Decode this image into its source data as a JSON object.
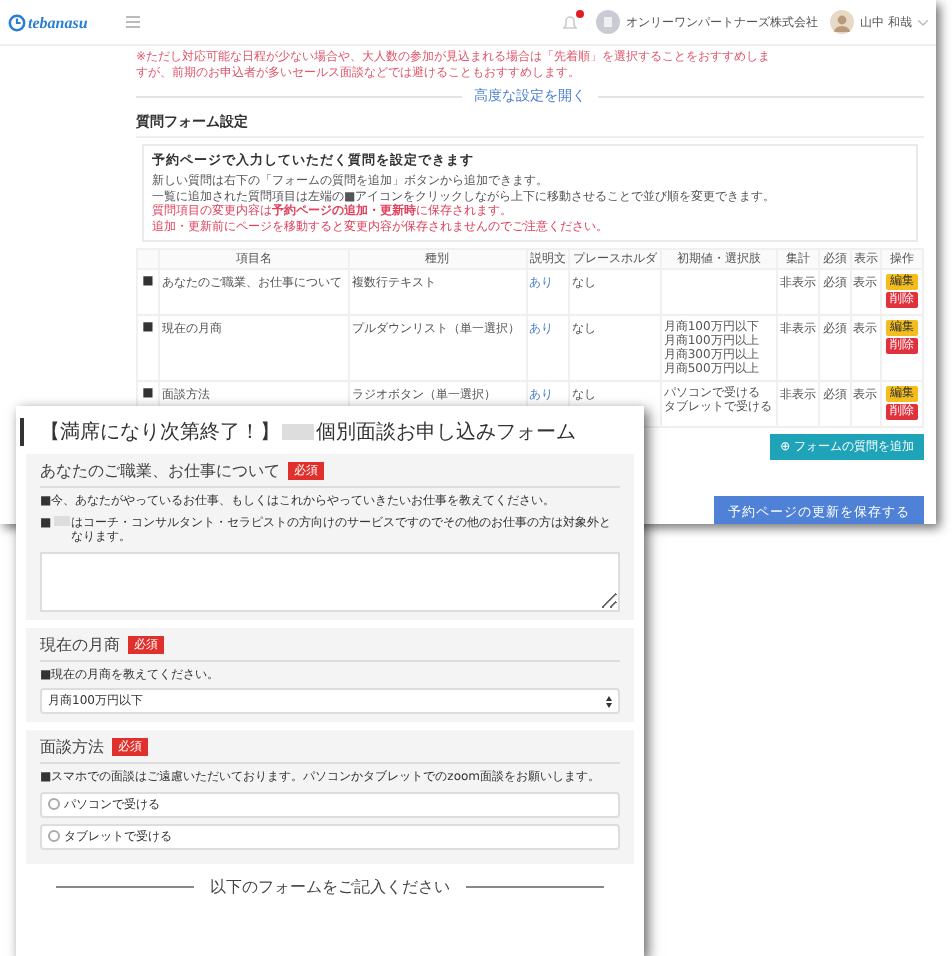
{
  "admin_window": {
    "header": {
      "logo": "tebanasu",
      "notification": true,
      "company": "オンリーワンパートナーズ株式会社",
      "user_name": "山中 和哉"
    },
    "notice_lines": [
      "※ただし対応可能な日程が少ない場合や、大人数の参加が見込まれる場合は「先着順」を選択することをおすすめしま",
      "すが、前期のお申込者が多いセールス面談などでは避けることもおすすめします。"
    ],
    "advanced_toggle": "高度な設定を開く",
    "section_title": "質問フォーム設定",
    "info_box": {
      "title": "予約ページで入力していただく質問を設定できます",
      "lines": [
        {
          "text": "新しい質問は右下の「フォームの質問を追加」ボタンから追加できます。",
          "kind": "normal"
        },
        {
          "text": "一覧に追加された質問項目は左端の■アイコンをクリックしながら上下に移動させることで並び順を変更できます。",
          "kind": "normal"
        },
        {
          "text": "質問項目の変更内容は**予約ページの追加・更新時**に保存されます。",
          "kind": "warning"
        },
        {
          "text": "追加・更新前にページを移動すると変更内容が保存されませんのでご注意ください。",
          "kind": "warning"
        }
      ]
    },
    "table": {
      "columns": [
        "項目名",
        "種別",
        "説明文",
        "プレースホルダ",
        "初期値・選択肢",
        "集計",
        "必須",
        "表示",
        "操作"
      ],
      "rows": [
        {
          "handle": "■",
          "name": "あなたのご職業、お仕事について",
          "type": "複数行テキスト",
          "description": "あり",
          "placeholder": "なし",
          "choices": [],
          "column_7": "非表示",
          "required": "必須",
          "display": "表示",
          "actions": [
            "編集",
            "削除"
          ]
        },
        {
          "handle": "■",
          "name": "現在の月商",
          "type": "プルダウンリスト（単一選択）",
          "description": "あり",
          "placeholder": "なし",
          "choices": [
            "月商100万円以下",
            "月商100万円以上",
            "月商300万円以上",
            "月商500万円以上"
          ],
          "column_7": "非表示",
          "required": "必須",
          "display": "表示",
          "actions": [
            "編集",
            "削除"
          ]
        },
        {
          "handle": "■",
          "name": "面談方法",
          "type": "ラジオボタン（単一選択）",
          "description": "あり",
          "placeholder": "なし",
          "choices": [
            "パソコンで受ける",
            "タブレットで受ける"
          ],
          "column_7": "非表示",
          "required": "必須",
          "display": "表示",
          "actions": [
            "編集",
            "削除"
          ]
        }
      ]
    },
    "add_button": "⊕ フォームの質問を追加",
    "save_button": "予約ページの更新を保存する"
  },
  "form_window": {
    "title_before": "【満席になり次第終了！】",
    "title_after": "個別面談お申し込みフォーム",
    "sections": [
      {
        "kind": "textarea",
        "title": "あなたのご職業、お仕事について",
        "badge": "必須",
        "notes": [
          {
            "prefix": "■今、あなたがやっているお仕事、もしくはこれからやっていきたいお仕事を教えてください。",
            "redacted": false
          },
          {
            "prefix": "■",
            "redacted": true,
            "text": "はコーチ・コンサルタント・セラピストの方向けのサービスですのでその他のお仕事の方は対象外となります。"
          }
        ]
      },
      {
        "kind": "select",
        "title": "現在の月商",
        "badge": "必須",
        "notes": [
          {
            "prefix": "■現在の月商を教えてください。",
            "redacted": false
          }
        ],
        "value": "月商100万円以下"
      },
      {
        "kind": "radio",
        "title": "面談方法",
        "badge": "必須",
        "notes": [
          {
            "prefix": "■スマホでの面談はご遠慮いただいております。パソコンかタブレットでのzoom面談をお願いします。",
            "redacted": false
          }
        ],
        "options": [
          {
            "label": "パソコンで受ける",
            "selected": false
          },
          {
            "label": "タブレットで受ける",
            "selected": false
          }
        ]
      }
    ],
    "divider_label": "以下のフォームをご記入ください"
  }
}
